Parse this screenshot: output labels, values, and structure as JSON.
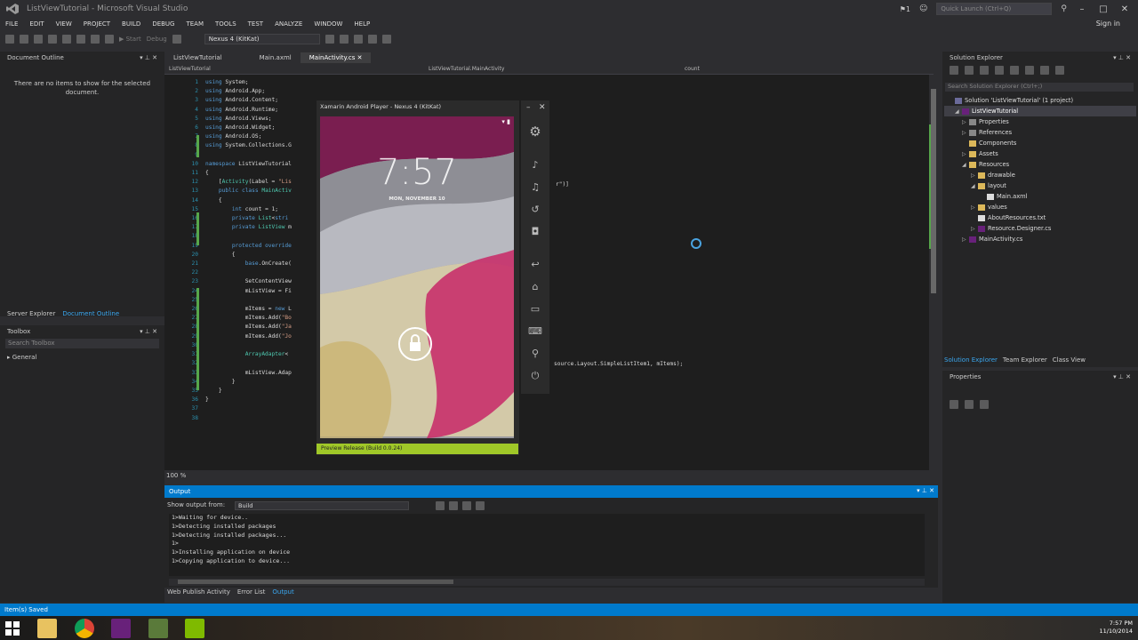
{
  "window": {
    "title": "ListViewTutorial - Microsoft Visual Studio",
    "quick_launch": "Quick Launch (Ctrl+Q)",
    "notif_count": "1",
    "sign_in": "Sign in"
  },
  "menu": [
    "FILE",
    "EDIT",
    "VIEW",
    "PROJECT",
    "BUILD",
    "DEBUG",
    "TEAM",
    "TOOLS",
    "TEST",
    "ANALYZE",
    "WINDOW",
    "HELP"
  ],
  "toolbar": {
    "start": "Start",
    "config": "Debug",
    "device": "Nexus 4 (KitKat)"
  },
  "document_outline": {
    "title": "Document Outline",
    "empty_text": "There are no items to show for the selected document."
  },
  "left_tabs": [
    "Server Explorer",
    "Document Outline"
  ],
  "toolbox": {
    "title": "Toolbox",
    "search_placeholder": "Search Toolbox",
    "group": "General"
  },
  "doc_tabs": [
    "ListViewTutorial",
    "Main.axml",
    "MainActivity.cs"
  ],
  "nav": {
    "project": "ListViewTutorial",
    "class": "ListViewTutorial.MainActivity",
    "member": "count"
  },
  "code": {
    "line_numbers": "1\n2\n3\n4\n5\n6\n7\n8\n9\n10\n11\n12\n13\n14\n15\n16\n17\n18\n19\n20\n21\n22\n23\n24\n25\n26\n27\n28\n29\n30\n31\n32\n33\n34\n35\n36\n37\n38",
    "right_fragment_1": "r\")]",
    "right_fragment_2": "source.Layout.SimpleListItem1, mItems);"
  },
  "zoom": "100 %",
  "emulator": {
    "title": "Xamarin Android Player - Nexus 4 (KitKat)",
    "time": "7:57",
    "date": "MON, NOVEMBER 10",
    "preview": "Preview Release (Build 0.0.24)"
  },
  "output": {
    "title": "Output",
    "show_from_label": "Show output from:",
    "source": "Build",
    "lines": "1>Waiting for device..\n1>Detecting installed packages\n1>Detecting installed packages...\n1>\n1>Installing application on device\n1>Copying application to device..."
  },
  "bottom_tabs": [
    "Web Publish Activity",
    "Error List",
    "Output"
  ],
  "solution_explorer": {
    "title": "Solution Explorer",
    "search_placeholder": "Search Solution Explorer (Ctrl+;)",
    "tree": [
      {
        "label": "Solution 'ListViewTutorial' (1 project)",
        "indent": 0
      },
      {
        "label": "ListViewTutorial",
        "indent": 1
      },
      {
        "label": "Properties",
        "indent": 2
      },
      {
        "label": "References",
        "indent": 2
      },
      {
        "label": "Components",
        "indent": 2
      },
      {
        "label": "Assets",
        "indent": 2
      },
      {
        "label": "Resources",
        "indent": 2
      },
      {
        "label": "drawable",
        "indent": 3
      },
      {
        "label": "layout",
        "indent": 3
      },
      {
        "label": "Main.axml",
        "indent": 4
      },
      {
        "label": "values",
        "indent": 3
      },
      {
        "label": "AboutResources.txt",
        "indent": 3
      },
      {
        "label": "Resource.Designer.cs",
        "indent": 3
      },
      {
        "label": "MainActivity.cs",
        "indent": 2
      }
    ]
  },
  "right_tabs": [
    "Solution Explorer",
    "Team Explorer",
    "Class View"
  ],
  "properties": {
    "title": "Properties"
  },
  "status": "Item(s) Saved",
  "tray": {
    "time": "7:57 PM",
    "date": "11/10/2014"
  },
  "colors": {
    "accent": "#007acc",
    "editor_bg": "#1e1e1e",
    "preview_green": "#a0c828",
    "keyword": "#569cd6"
  }
}
